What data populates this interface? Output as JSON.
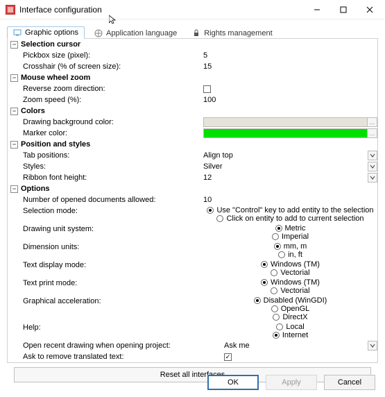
{
  "window": {
    "title": "Interface configuration"
  },
  "tabs": {
    "graphic": "Graphic options",
    "language": "Application language",
    "rights": "Rights management"
  },
  "groups": {
    "selection": {
      "title": "Selection cursor",
      "pickbox": {
        "label": "Pickbox size (pixel):",
        "value": "5"
      },
      "crosshair": {
        "label": "Crosshair (% of screen size):",
        "value": "15"
      }
    },
    "wheel": {
      "title": "Mouse wheel zoom",
      "reverse": {
        "label": "Reverse zoom direction:"
      },
      "speed": {
        "label": "Zoom speed (%):",
        "value": "100"
      }
    },
    "colors": {
      "title": "Colors",
      "bg": {
        "label": "Drawing background color:",
        "color": "#e6e3da"
      },
      "marker": {
        "label": "Marker color:",
        "color": "#00e000"
      }
    },
    "position": {
      "title": "Position and styles",
      "tabpos": {
        "label": "Tab positions:",
        "value": "Align top"
      },
      "styles": {
        "label": "Styles:",
        "value": "Silver"
      },
      "ribbon": {
        "label": "Ribbon font height:",
        "value": "12"
      }
    },
    "options": {
      "title": "Options",
      "docs": {
        "label": "Number of opened documents allowed:",
        "value": "10"
      },
      "selmode": {
        "label": "Selection mode:",
        "opt1": "Use \"Control\" key to add entity to the selection",
        "opt2": "Click on entity to add to current selection"
      },
      "unit": {
        "label": "Drawing unit system:",
        "opt1": "Metric",
        "opt2": "Imperial"
      },
      "dim": {
        "label": "Dimension units:",
        "opt1": "mm, m",
        "opt2": "in, ft"
      },
      "textdisp": {
        "label": "Text display mode:",
        "opt1": "Windows (TM)",
        "opt2": "Vectorial"
      },
      "textprint": {
        "label": "Text print mode:",
        "opt1": "Windows (TM)",
        "opt2": "Vectorial"
      },
      "accel": {
        "label": "Graphical acceleration:",
        "opt1": "Disabled (WinGDI)",
        "opt2": "OpenGL",
        "opt3": "DirectX"
      },
      "help": {
        "label": "Help:",
        "opt1": "Local",
        "opt2": "Internet"
      },
      "openrecent": {
        "label": "Open recent drawing when opening project:",
        "value": "Ask me"
      },
      "askremove": {
        "label": "Ask to remove translated text:"
      }
    }
  },
  "reset": "Reset all interfaces",
  "buttons": {
    "ok": "OK",
    "apply": "Apply",
    "cancel": "Cancel"
  }
}
